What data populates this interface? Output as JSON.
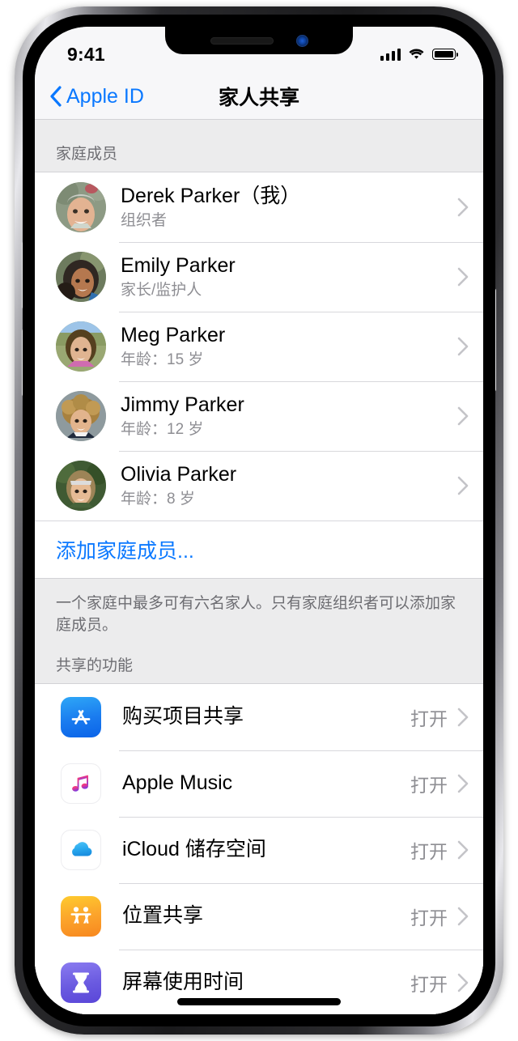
{
  "status_bar": {
    "time": "9:41",
    "signal_icon": "cellular-bars-icon",
    "wifi_icon": "wifi-icon",
    "battery_icon": "battery-full-icon"
  },
  "nav": {
    "back_label": "Apple ID",
    "back_icon": "chevron-left-icon",
    "title": "家人共享"
  },
  "members_section": {
    "header": "家庭成员",
    "members": [
      {
        "name": "Derek Parker（我）",
        "detail": "组织者",
        "avatar": "avatar-derek"
      },
      {
        "name": "Emily Parker",
        "detail": "家长/监护人",
        "avatar": "avatar-emily"
      },
      {
        "name": "Meg Parker",
        "detail": "年龄：15 岁",
        "avatar": "avatar-meg"
      },
      {
        "name": "Jimmy Parker",
        "detail": "年龄：12 岁",
        "avatar": "avatar-jimmy"
      },
      {
        "name": "Olivia Parker",
        "detail": "年龄：8 岁",
        "avatar": "avatar-olivia"
      }
    ],
    "add_member_label": "添加家庭成员...",
    "footer_note": "一个家庭中最多可有六名家人。只有家庭组织者可以添加家庭成员。"
  },
  "features_section": {
    "header": "共享的功能",
    "features": [
      {
        "label": "购买项目共享",
        "value": "打开",
        "icon": "app-store-icon"
      },
      {
        "label": "Apple Music",
        "value": "打开",
        "icon": "apple-music-icon"
      },
      {
        "label": "iCloud 储存空间",
        "value": "打开",
        "icon": "icloud-icon"
      },
      {
        "label": "位置共享",
        "value": "打开",
        "icon": "find-my-icon"
      },
      {
        "label": "屏幕使用时间",
        "value": "打开",
        "icon": "screen-time-icon"
      }
    ]
  },
  "colors": {
    "accent_blue": "#0a78ff",
    "secondary_text": "#8e8e93",
    "group_background": "#ececed",
    "separator": "#d8d8dc"
  }
}
